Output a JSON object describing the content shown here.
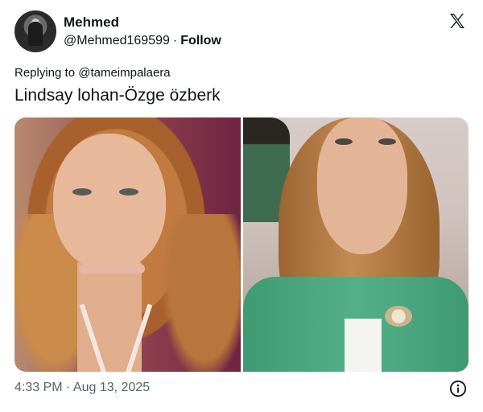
{
  "author": {
    "name": "Mehmed",
    "handle": "@Mehmed169599",
    "separator": "·",
    "follow_label": "Follow"
  },
  "platform_icon": "x-logo-icon",
  "reply": {
    "text": "Replying to @tameimpalaera"
  },
  "tweet": {
    "text": "Lindsay lohan-Özge özberk"
  },
  "media": [
    {
      "subject": "left-photo"
    },
    {
      "subject": "right-photo"
    }
  ],
  "footer": {
    "timestamp": "4:33 PM · Aug 13, 2025",
    "info_icon": "info-icon"
  },
  "colors": {
    "text": "#0f1419",
    "secondary": "#536471",
    "background": "#ffffff"
  }
}
